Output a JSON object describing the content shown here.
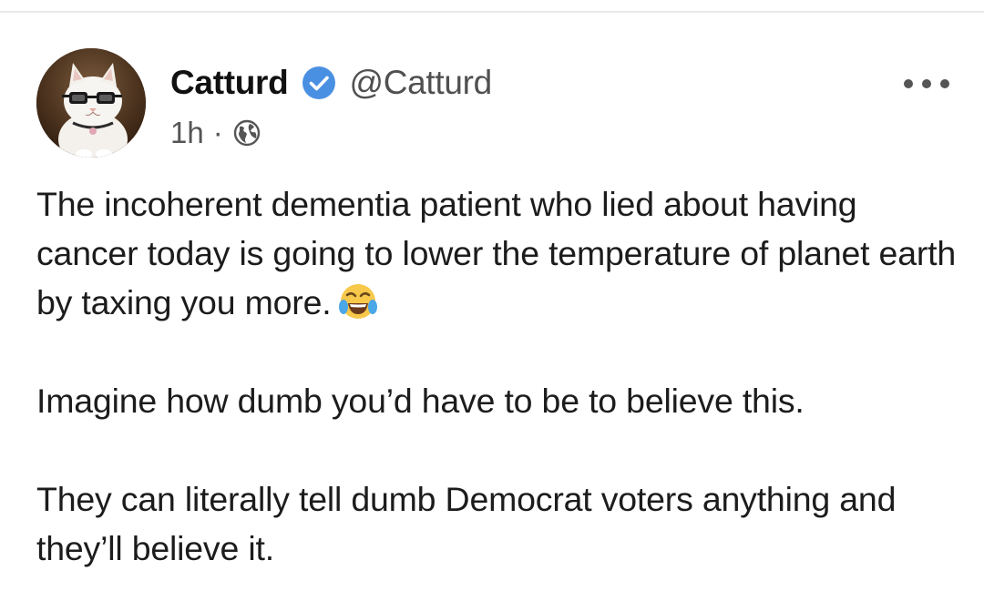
{
  "post": {
    "author": {
      "display_name": "Catturd",
      "handle": "@Catturd",
      "verified": true,
      "avatar": "cat-with-glasses-avatar"
    },
    "timestamp": "1h",
    "separator": "·",
    "audience_icon": "globe-icon",
    "more_icon": "more-dots-icon",
    "paragraphs": [
      "The incoherent dementia patient who lied about having cancer today is going to lower the temperature of planet earth by taxing you more.",
      "Imagine how dumb you’d have to be to believe this.",
      "They can literally tell dumb Democrat voters anything and they’ll believe it."
    ],
    "emoji": "face-with-tears-of-joy-emoji"
  },
  "colors": {
    "verified_badge": "#4a90e2",
    "text": "#1c1c1c",
    "secondary_text": "#555555",
    "background": "#ffffff"
  }
}
